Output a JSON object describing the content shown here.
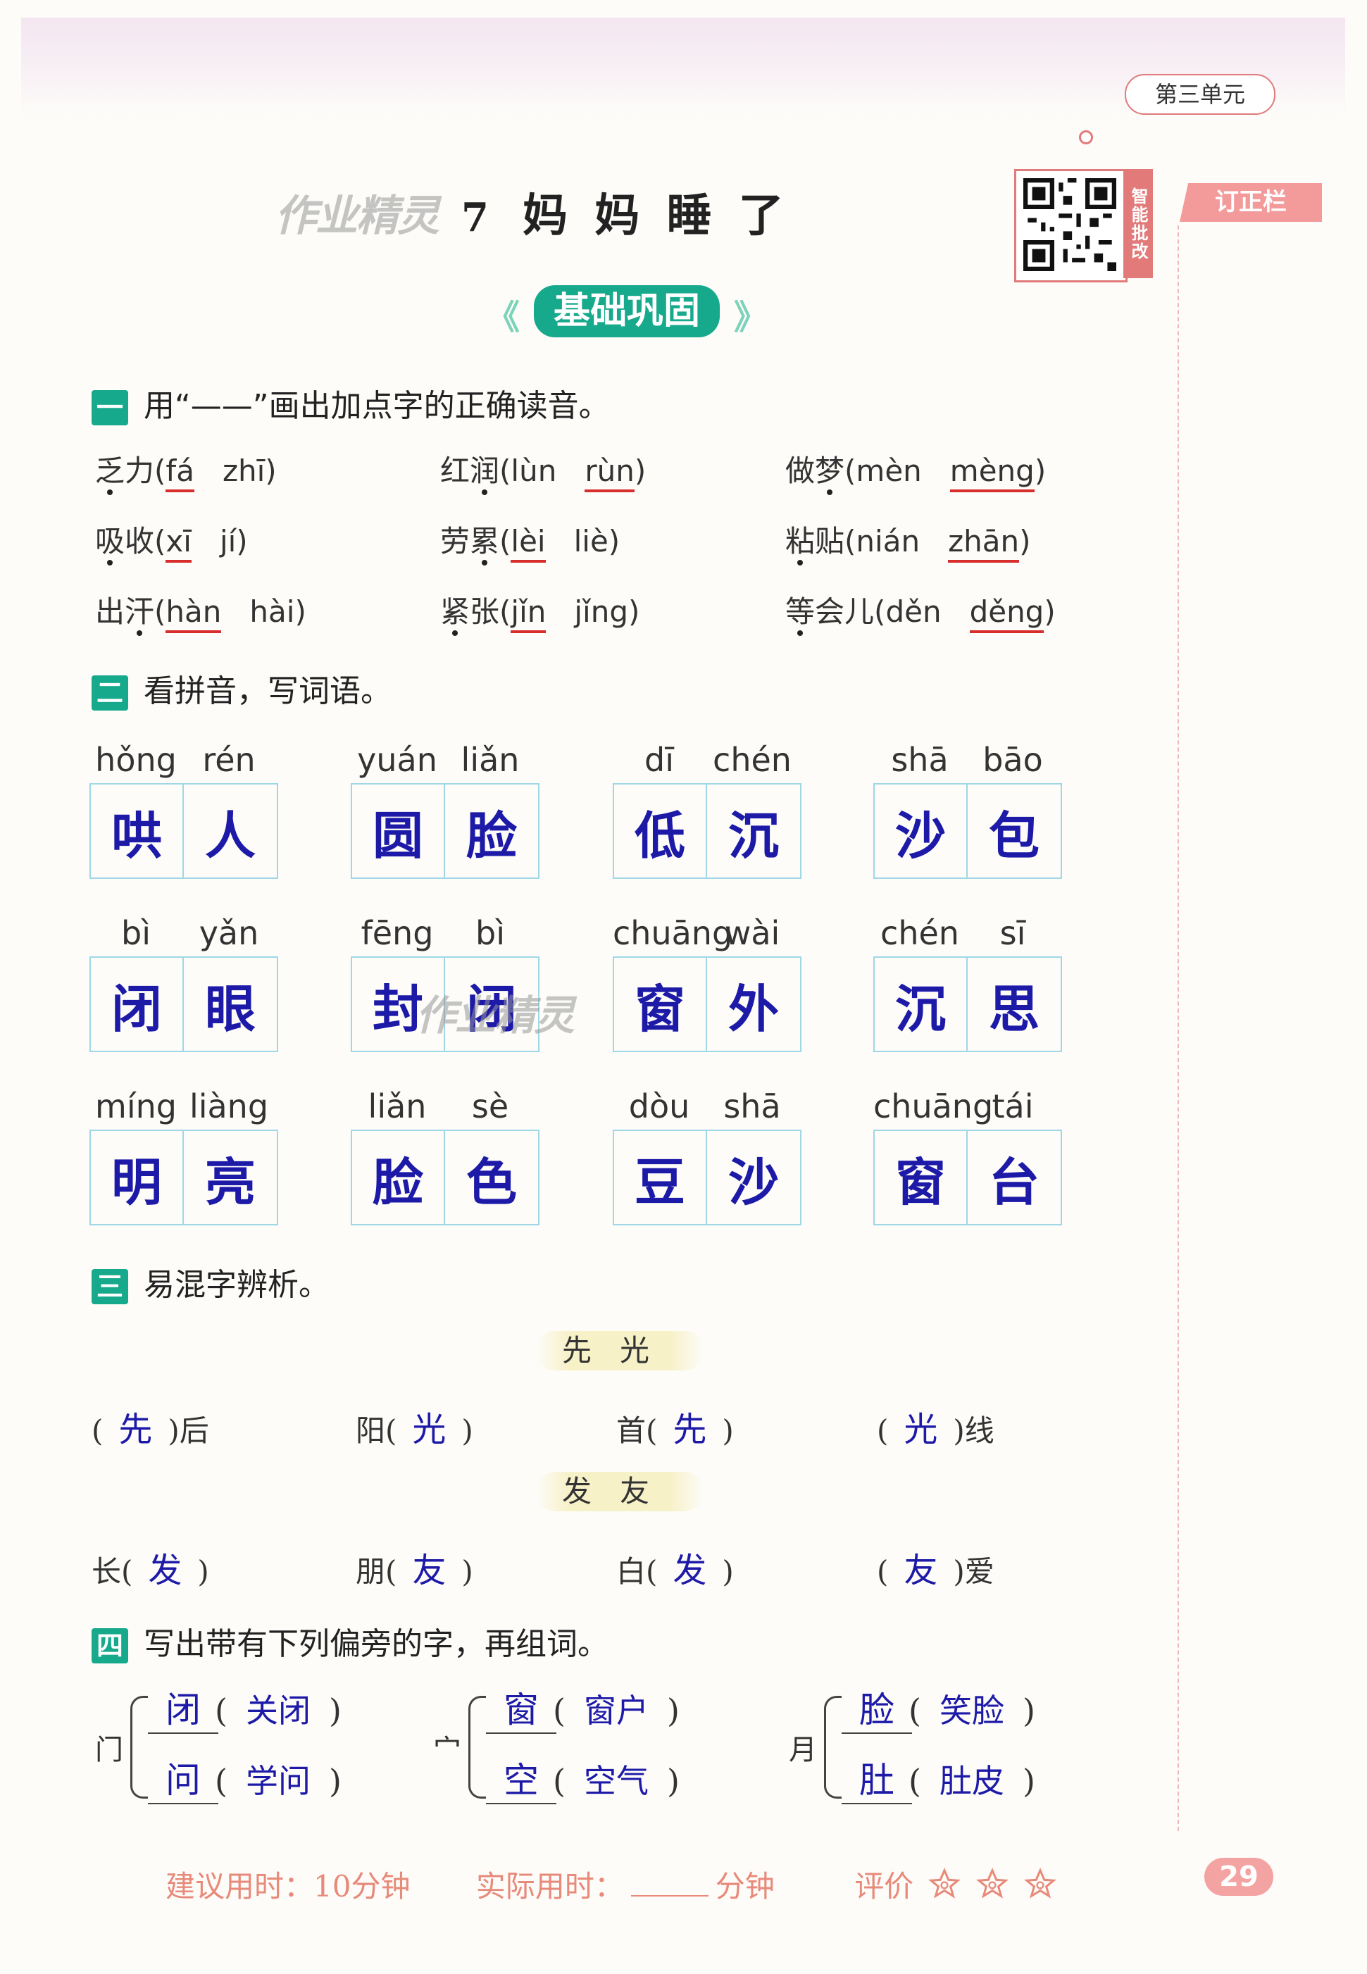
{
  "header": {
    "unit_tag": "第三单元",
    "correction_label": "订正栏",
    "qr_label": "智能批改",
    "watermark": "作业精灵"
  },
  "lesson": {
    "number": "7",
    "title": "妈 妈 睡 了"
  },
  "banner": "基础巩固",
  "section1": {
    "num": "一",
    "instruction": "用“——”画出加点字的正确读音。",
    "items": [
      {
        "word": [
          "乏",
          "力"
        ],
        "dotted": 0,
        "opts": [
          "fá",
          "zhī"
        ],
        "correct": 0
      },
      {
        "word": [
          "红",
          "润"
        ],
        "dotted": 1,
        "opts": [
          "lùn",
          "rùn"
        ],
        "correct": 1
      },
      {
        "word": [
          "做",
          "梦"
        ],
        "dotted": 1,
        "opts": [
          "mèn",
          "mèng"
        ],
        "correct": 1
      },
      {
        "word": [
          "吸",
          "收"
        ],
        "dotted": 0,
        "opts": [
          "xī",
          "jí"
        ],
        "correct": 0
      },
      {
        "word": [
          "劳",
          "累"
        ],
        "dotted": 1,
        "opts": [
          "lèi",
          "liè"
        ],
        "correct": 0
      },
      {
        "word": [
          "粘",
          "贴"
        ],
        "dotted": 0,
        "opts": [
          "nián",
          "zhān"
        ],
        "correct": 1
      },
      {
        "word": [
          "出",
          "汗"
        ],
        "dotted": 1,
        "opts": [
          "hàn",
          "hài"
        ],
        "correct": 0
      },
      {
        "word": [
          "紧",
          "张"
        ],
        "dotted": 0,
        "opts": [
          "jǐn",
          "jǐng"
        ],
        "correct": 0
      },
      {
        "word": [
          "等",
          "会",
          "儿"
        ],
        "dotted": 0,
        "opts": [
          "děn",
          "děng"
        ],
        "correct": 1
      }
    ]
  },
  "section2": {
    "num": "二",
    "instruction": "看拼音，写词语。",
    "items": [
      {
        "pinyin": [
          "hǒng",
          "rén"
        ],
        "chars": [
          "哄",
          "人"
        ]
      },
      {
        "pinyin": [
          "yuán",
          "liǎn"
        ],
        "chars": [
          "圆",
          "脸"
        ]
      },
      {
        "pinyin": [
          "dī",
          "chén"
        ],
        "chars": [
          "低",
          "沉"
        ]
      },
      {
        "pinyin": [
          "shā",
          "bāo"
        ],
        "chars": [
          "沙",
          "包"
        ]
      },
      {
        "pinyin": [
          "bì",
          "yǎn"
        ],
        "chars": [
          "闭",
          "眼"
        ]
      },
      {
        "pinyin": [
          "fēng",
          "bì"
        ],
        "chars": [
          "封",
          "闭"
        ]
      },
      {
        "pinyin": [
          "chuāng",
          "wài"
        ],
        "chars": [
          "窗",
          "外"
        ]
      },
      {
        "pinyin": [
          "chén",
          "sī"
        ],
        "chars": [
          "沉",
          "思"
        ]
      },
      {
        "pinyin": [
          "míng",
          "liàng"
        ],
        "chars": [
          "明",
          "亮"
        ]
      },
      {
        "pinyin": [
          "liǎn",
          "sè"
        ],
        "chars": [
          "脸",
          "色"
        ]
      },
      {
        "pinyin": [
          "dòu",
          "shā"
        ],
        "chars": [
          "豆",
          "沙"
        ]
      },
      {
        "pinyin": [
          "chuāng",
          "tái"
        ],
        "chars": [
          "窗",
          "台"
        ]
      }
    ]
  },
  "section3": {
    "num": "三",
    "instruction": "易混字辨析。",
    "groups": [
      {
        "pair": "先光",
        "items": [
          {
            "before": "(",
            "answer": "先",
            "after": ")后"
          },
          {
            "before": "阳(",
            "answer": "光",
            "after": ")"
          },
          {
            "before": "首(",
            "answer": "先",
            "after": ")"
          },
          {
            "before": "(",
            "answer": "光",
            "after": ")线"
          }
        ]
      },
      {
        "pair": "发友",
        "items": [
          {
            "before": "长(",
            "answer": "发",
            "after": ")"
          },
          {
            "before": "朋(",
            "answer": "友",
            "after": ")"
          },
          {
            "before": "白(",
            "answer": "发",
            "after": ")"
          },
          {
            "before": "(",
            "answer": "友",
            "after": ")爱"
          }
        ]
      }
    ]
  },
  "section4": {
    "num": "四",
    "instruction": "写出带有下列偏旁的字，再组词。",
    "groups": [
      {
        "radical": "门",
        "rows": [
          {
            "char": "闭",
            "word": "关闭"
          },
          {
            "char": "问",
            "word": "学问"
          }
        ]
      },
      {
        "radical": "宀",
        "rows": [
          {
            "char": "窗",
            "word": "窗户"
          },
          {
            "char": "空",
            "word": "空气"
          }
        ]
      },
      {
        "radical": "月",
        "rows": [
          {
            "char": "脸",
            "word": "笑脸"
          },
          {
            "char": "肚",
            "word": "肚皮"
          }
        ]
      }
    ]
  },
  "footer": {
    "suggest": "建议用时：10分钟",
    "actual_prefix": "实际用时：",
    "actual_suffix": "分钟",
    "rating": "评价"
  },
  "page_number": "29"
}
